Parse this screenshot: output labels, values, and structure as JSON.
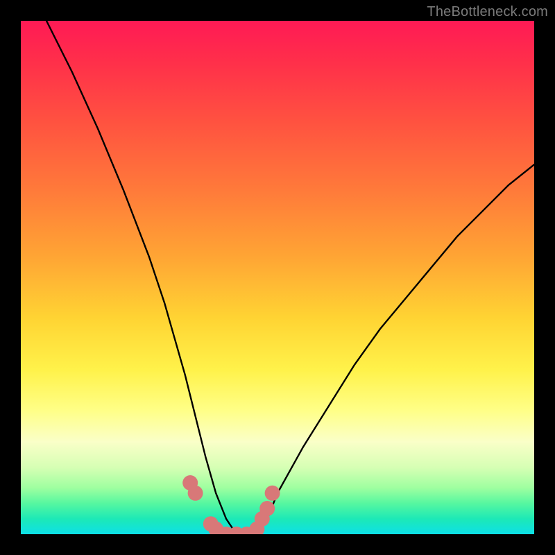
{
  "watermark": "TheBottleneck.com",
  "chart_data": {
    "type": "line",
    "title": "",
    "xlabel": "",
    "ylabel": "",
    "xlim": [
      0,
      100
    ],
    "ylim": [
      0,
      100
    ],
    "grid": false,
    "legend": false,
    "annotations": [],
    "series": [
      {
        "name": "bottleneck-curve",
        "x": [
          5,
          10,
          15,
          20,
          25,
          28,
          30,
          32,
          34,
          36,
          38,
          40,
          42,
          44,
          46,
          48,
          50,
          55,
          60,
          65,
          70,
          75,
          80,
          85,
          90,
          95,
          100
        ],
        "values": [
          100,
          90,
          79,
          67,
          54,
          45,
          38,
          31,
          23,
          15,
          8,
          3,
          0,
          0,
          0,
          3,
          8,
          17,
          25,
          33,
          40,
          46,
          52,
          58,
          63,
          68,
          72
        ]
      },
      {
        "name": "highlight-dots",
        "x": [
          33,
          34,
          37,
          38,
          40,
          42,
          44,
          46,
          47,
          48,
          49
        ],
        "values": [
          10,
          8,
          2,
          1,
          0,
          0,
          0,
          1,
          3,
          5,
          8
        ]
      }
    ],
    "gradient_stops": [
      {
        "pos": 0,
        "color": "#ff1a55"
      },
      {
        "pos": 8,
        "color": "#ff2f4a"
      },
      {
        "pos": 20,
        "color": "#ff5340"
      },
      {
        "pos": 33,
        "color": "#ff7a3a"
      },
      {
        "pos": 46,
        "color": "#ffa534"
      },
      {
        "pos": 58,
        "color": "#ffd433"
      },
      {
        "pos": 68,
        "color": "#fff24a"
      },
      {
        "pos": 76,
        "color": "#ffff88"
      },
      {
        "pos": 82,
        "color": "#faffc8"
      },
      {
        "pos": 87,
        "color": "#d6ffb4"
      },
      {
        "pos": 91,
        "color": "#9effa0"
      },
      {
        "pos": 94,
        "color": "#56f7a0"
      },
      {
        "pos": 97,
        "color": "#1de9b6"
      },
      {
        "pos": 100,
        "color": "#0de0e8"
      }
    ],
    "dot_color": "#d87878",
    "curve_color": "#000000"
  }
}
